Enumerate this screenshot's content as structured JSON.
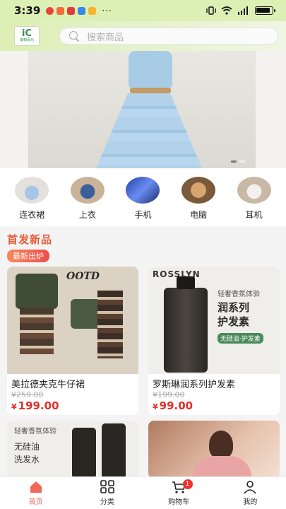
{
  "status": {
    "time": "3:39",
    "more": "···",
    "battery_level": 0.9
  },
  "header": {
    "logo_mark": "iC",
    "logo_text": "掌到百元",
    "search_placeholder": "搜索商品"
  },
  "banner": {
    "slides": 2,
    "active_slide": 1
  },
  "categories": [
    {
      "label": "连衣裙",
      "icon": "dress-icon"
    },
    {
      "label": "上衣",
      "icon": "top-icon"
    },
    {
      "label": "手机",
      "icon": "phone-icon"
    },
    {
      "label": "电脑",
      "icon": "laptop-icon"
    },
    {
      "label": "耳机",
      "icon": "earphones-icon"
    }
  ],
  "section": {
    "title": "首发新品",
    "tag": "最新出炉"
  },
  "products": [
    {
      "name": "美拉德夹克牛仔裙",
      "original_price": "¥259.00",
      "currency": "¥",
      "price": "199.00",
      "image_text": "OOTD"
    },
    {
      "name": "罗斯琳润系列护发素",
      "original_price": "¥199.00",
      "currency": "¥",
      "price": "99.00",
      "image_text": "ROSSLYN",
      "image_tag": "润系列\n护发素",
      "image_subtag": "无硅油·护发素",
      "image_top": "轻奢香氛体验"
    },
    {
      "name": "",
      "image_top": "轻奢香氛体验",
      "image_text": "无硅油\n洗发水"
    },
    {
      "name": ""
    }
  ],
  "tabbar": {
    "items": [
      {
        "label": "首页",
        "icon": "home-icon"
      },
      {
        "label": "分类",
        "icon": "grid-icon"
      },
      {
        "label": "购物车",
        "icon": "cart-icon",
        "badge": "1"
      },
      {
        "label": "我的",
        "icon": "user-icon"
      }
    ]
  },
  "colors": {
    "accent": "#f06a5a",
    "price": "#e0312a",
    "header_bg": "#dcefb5"
  }
}
